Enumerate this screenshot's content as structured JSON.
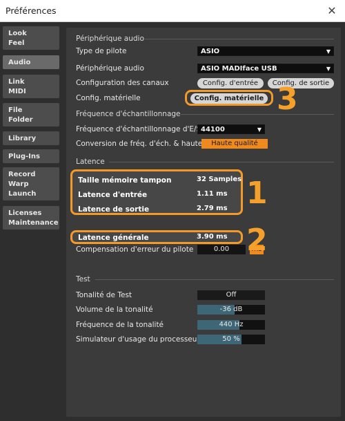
{
  "window": {
    "title": "Préférences",
    "close_glyph": "✕"
  },
  "sidebar": {
    "tabs": [
      {
        "label": "Look\nFeel",
        "active": false
      },
      {
        "label": "Audio",
        "active": true
      },
      {
        "label": "Link\nMIDI",
        "active": false
      },
      {
        "label": "File\nFolder",
        "active": false
      },
      {
        "label": "Library",
        "active": false
      },
      {
        "label": "Plug-Ins",
        "active": false
      },
      {
        "label": "Record\nWarp\nLaunch",
        "active": false
      },
      {
        "label": "Licenses\nMaintenance",
        "active": false
      }
    ]
  },
  "audio_device": {
    "section": "Périphérique audio",
    "driver_type_label": "Type de pilote",
    "driver_type_value": "ASIO",
    "device_label": "Périphérique audio",
    "device_value": "ASIO MADIface USB",
    "channel_config_label": "Configuration des canaux",
    "input_config_button": "Config. d'entrée",
    "output_config_button": "Config. de sortie",
    "hardware_config_label": "Config. matérielle",
    "hardware_config_button": "Config. matérielle"
  },
  "sample_rate": {
    "section": "Fréquence d'échantillonnage",
    "io_rate_label": "Fréquence d'échantillonnage d'E/S",
    "io_rate_value": "44100",
    "conversion_label": "Conversion de fréq. d'éch. & hauteur",
    "conversion_value": "Haute qualité"
  },
  "latency": {
    "section": "Latence",
    "buffer_size_label": "Taille mémoire tampon",
    "buffer_size_value": "32 Samples",
    "input_latency_label": "Latence d'entrée",
    "input_latency_value": "1.11 ms",
    "output_latency_label": "Latence de sortie",
    "output_latency_value": "2.79 ms",
    "driver_comp_label": "Compensation d'erreur du pilote",
    "driver_comp_value": "0.00",
    "driver_comp_unit": "ms",
    "overall_label": "Latence générale",
    "overall_value": "3.90 ms"
  },
  "test": {
    "section": "Test",
    "tone_label": "Tonalité de Test",
    "tone_value": "Off",
    "volume_label": "Volume de la tonalité",
    "volume_value": "-36 dB",
    "volume_fill": 0.55,
    "frequency_label": "Fréquence de la tonalité",
    "frequency_value": "440 Hz",
    "frequency_fill": 0.62,
    "cpu_label": "Simulateur d'usage du processeur",
    "cpu_value": "50 %",
    "cpu_fill": 0.65
  },
  "annotations": {
    "one": "1",
    "two": "2",
    "three": "3"
  },
  "colors": {
    "accent": "#f18a1c",
    "annotation": "#f39a2a",
    "slider_fill": "#3d6777"
  }
}
